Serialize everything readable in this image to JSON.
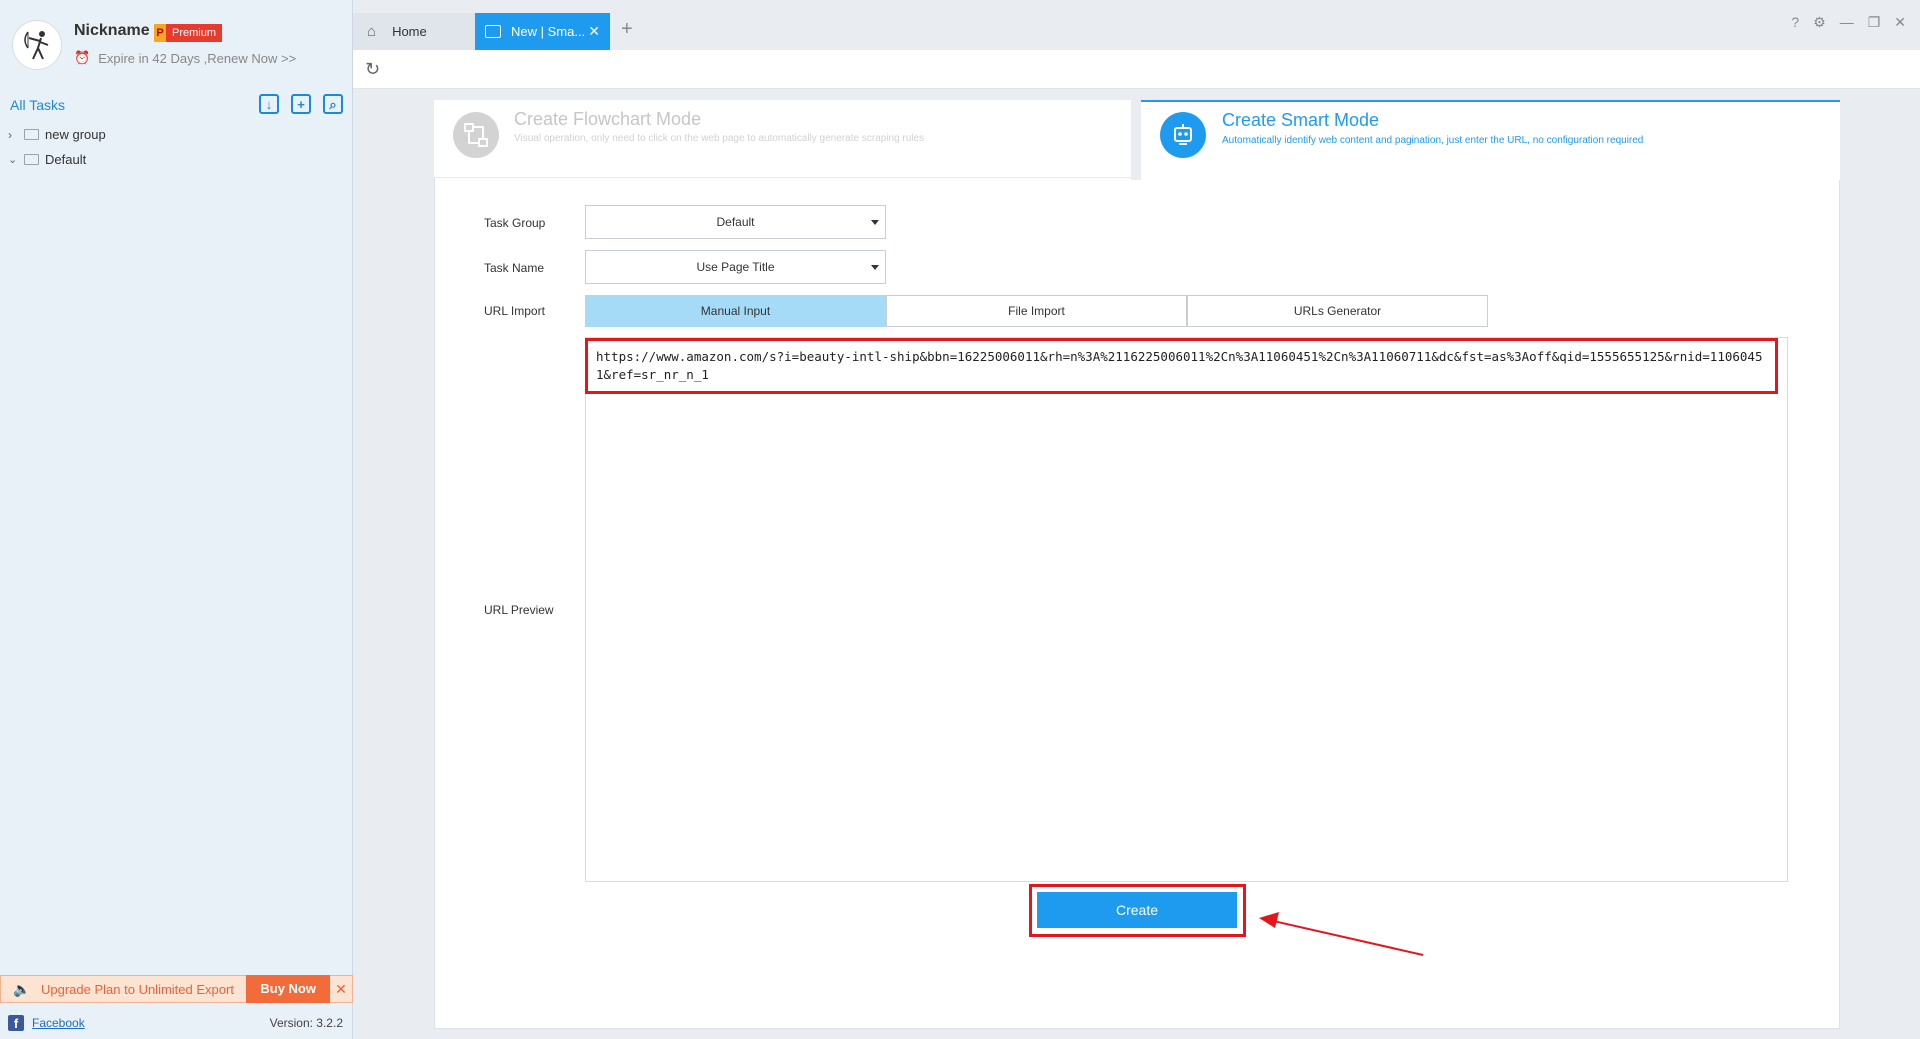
{
  "profile": {
    "nickname": "Nickname",
    "badge_letter": "P",
    "badge_label": "Premium",
    "expire_text": "Expire in 42 Days ,Renew Now >>"
  },
  "sidebar": {
    "all_tasks_label": "All Tasks",
    "tree": [
      {
        "label": "new group",
        "expanded": false
      },
      {
        "label": "Default",
        "expanded": true
      }
    ],
    "upgrade_text": "Upgrade Plan to Unlimited Export",
    "buy_label": "Buy Now",
    "facebook_label": "Facebook",
    "version": "Version: 3.2.2"
  },
  "tabs": {
    "home_label": "Home",
    "active_label": "New | Sma..."
  },
  "modes": {
    "flowchart": {
      "title": "Create Flowchart Mode",
      "desc": "Visual operation, only need to click on the web page to automatically generate scraping rules"
    },
    "smart": {
      "title": "Create Smart Mode",
      "desc": "Automatically identify web content and pagination, just enter the URL, no configuration required"
    }
  },
  "form": {
    "task_group_label": "Task Group",
    "task_group_value": "Default",
    "task_name_label": "Task Name",
    "task_name_value": "Use Page Title",
    "url_import_label": "URL Import",
    "import_options": [
      "Manual Input",
      "File Import",
      "URLs Generator"
    ],
    "url_preview_label": "URL Preview",
    "url_value": "https://www.amazon.com/s?i=beauty-intl-ship&bbn=16225006011&rh=n%3A%2116225006011%2Cn%3A11060451%2Cn%3A11060711&dc&fst=as%3Aoff&qid=1555655125&rnid=11060451&ref=sr_nr_n_1",
    "create_label": "Create"
  },
  "colors": {
    "accent": "#1e9bef",
    "highlight": "#e3161e"
  }
}
